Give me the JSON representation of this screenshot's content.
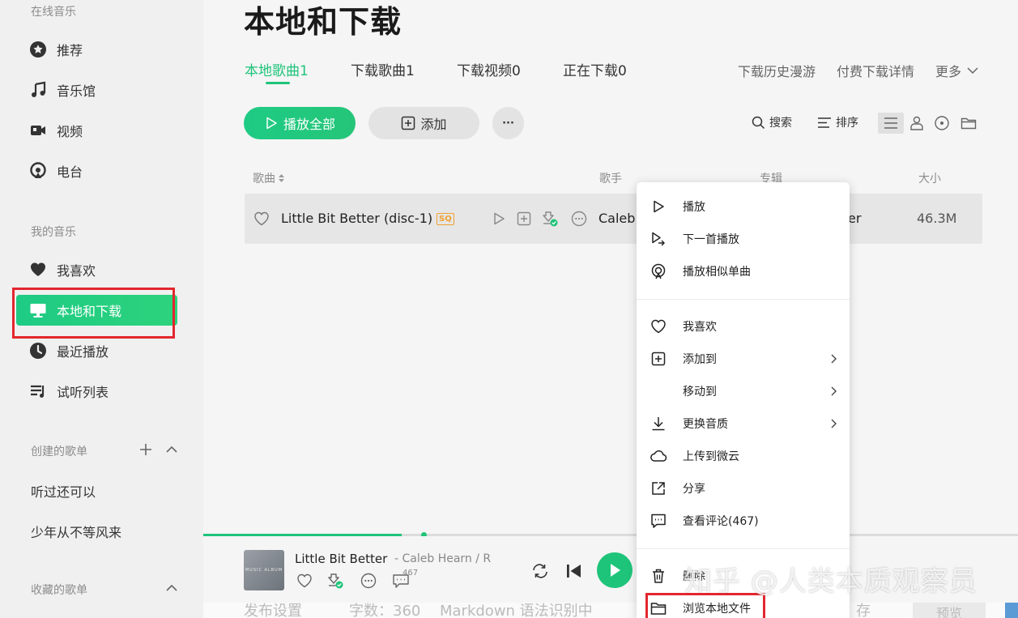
{
  "sidebar": {
    "online_title": "在线音乐",
    "online_items": [
      {
        "label": "推荐",
        "icon": "star-badge-icon"
      },
      {
        "label": "音乐馆",
        "icon": "music-note-icon"
      },
      {
        "label": "视频",
        "icon": "video-icon"
      },
      {
        "label": "电台",
        "icon": "radio-icon"
      }
    ],
    "my_music_title": "我的音乐",
    "my_items": [
      {
        "label": "我喜欢",
        "icon": "heart-icon"
      },
      {
        "label": "本地和下载",
        "icon": "monitor-icon",
        "active": true
      },
      {
        "label": "最近播放",
        "icon": "clock-icon"
      },
      {
        "label": "试听列表",
        "icon": "playlist-icon"
      }
    ],
    "created_title": "创建的歌单",
    "created_playlists": [
      "听过还可以",
      "少年从不等风来"
    ],
    "collected_title": "收藏的歌单"
  },
  "main": {
    "title": "本地和下载",
    "tabs": [
      "本地歌曲1",
      "下载歌曲1",
      "下载视频0",
      "正在下载0"
    ],
    "active_tab": 0,
    "top_links": [
      "下载历史漫游",
      "付费下载详情",
      "更多"
    ],
    "play_all_label": "播放全部",
    "add_label": "添加",
    "more_label": "···",
    "search_label": "搜索",
    "sort_label": "排序",
    "columns": {
      "song": "歌曲",
      "artist": "歌手",
      "album": "专辑",
      "size": "大小"
    },
    "song": {
      "title": "Little Bit Better (disc-1)",
      "quality_badge": "SQ",
      "artist": "Caleb",
      "album": "er",
      "size": "46.3M"
    }
  },
  "player": {
    "progress": 0.27,
    "cover_text": "MUSIC ALBUM",
    "title": "Little Bit Better",
    "artist": "- Caleb Hearn / R(",
    "comment_count": "467"
  },
  "editor_strip": {
    "publish_settings": "发布设置",
    "word_count": "字数：360",
    "markdown_hint": "Markdown 语法识别中",
    "right_text": "存",
    "preview": "预览"
  },
  "context_menu": {
    "group1": [
      {
        "label": "播放",
        "icon": "play-icon"
      },
      {
        "label": "下一首播放",
        "icon": "play-next-icon"
      },
      {
        "label": "播放相似单曲",
        "icon": "radar-icon"
      }
    ],
    "group2": [
      {
        "label": "我喜欢",
        "icon": "heart-outline-icon",
        "submenu": false
      },
      {
        "label": "添加到",
        "icon": "add-box-icon",
        "submenu": true
      },
      {
        "label": "移动到",
        "icon": "",
        "submenu": true
      },
      {
        "label": "更换音质",
        "icon": "download-icon",
        "submenu": true
      },
      {
        "label": "上传到微云",
        "icon": "cloud-icon",
        "submenu": false
      },
      {
        "label": "分享",
        "icon": "share-icon",
        "submenu": false
      },
      {
        "label": "查看评论(467)",
        "icon": "comment-icon",
        "submenu": false
      }
    ],
    "group3": [
      {
        "label": "删除",
        "icon": "trash-icon"
      },
      {
        "label": "浏览本地文件",
        "icon": "folder-icon"
      }
    ]
  },
  "watermark": "知乎 @人类本质观察员",
  "colors": {
    "accent": "#1ec47a",
    "highlight_box": "#e3262e",
    "sq_badge": "#f0a030"
  }
}
